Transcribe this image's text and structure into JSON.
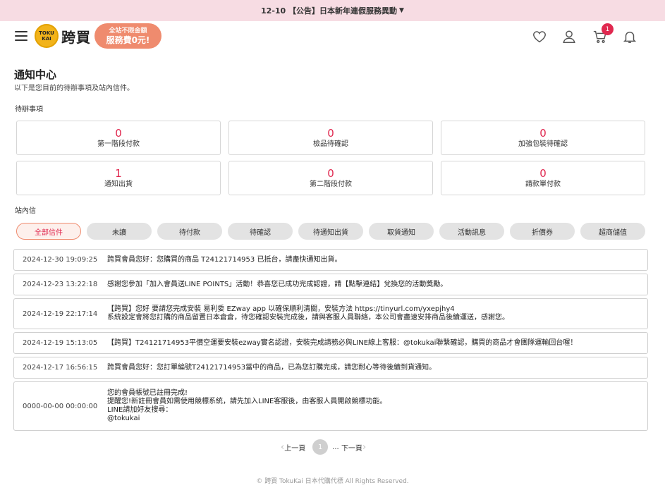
{
  "announcement": {
    "date": "12-10",
    "text": "【公告】日本新年連假服務異動"
  },
  "header": {
    "logo_badge_line1": "TOKU",
    "logo_badge_line2": "KAI",
    "logo_text": "跨買",
    "promo_line1": "全站不限金額",
    "promo_line2": "服務費0元!",
    "cart_count": "1",
    "icons": [
      "menu-icon",
      "heart-icon",
      "user-icon",
      "cart-icon",
      "bell-icon"
    ]
  },
  "page": {
    "title": "通知中心",
    "subtitle": "以下是您目前的待辦事項及站內信件。"
  },
  "todo": {
    "section_label": "待辦事項",
    "items": [
      {
        "count": "0",
        "label": "第一階段付款"
      },
      {
        "count": "0",
        "label": "檢品待確認"
      },
      {
        "count": "0",
        "label": "加強包裝待確認"
      },
      {
        "count": "1",
        "label": "通知出貨"
      },
      {
        "count": "0",
        "label": "第二階段付款"
      },
      {
        "count": "0",
        "label": "請款單付款"
      }
    ]
  },
  "inbox": {
    "section_label": "站內信",
    "tabs": [
      "全部信件",
      "未讀",
      "待付款",
      "待確認",
      "待通知出貨",
      "取貨通知",
      "活動訊息",
      "折價券",
      "超商儲值"
    ],
    "active_tab": "全部信件",
    "messages": [
      {
        "date": "2024-12-30 19:09:25",
        "lines": [
          "跨買會員您好：您購買的商品 T24121714953 已抵台，請盡快通知出貨。"
        ]
      },
      {
        "date": "2024-12-23 13:22:18",
        "lines": [
          "感謝您參加「加入會員送LINE POINTS」活動！恭喜您已成功完成認證，請【點擊連結】兌換您的活動獎勵。"
        ]
      },
      {
        "date": "2024-12-19 22:17:14",
        "lines": [
          "【跨買】您好 要請您完成安裝 易利委 EZway app 以確保順利清關，安裝方法 https://tinyurl.com/yxepjhy4",
          "系統設定會將您訂購的商品留置日本倉倉，待您確認安裝完成後，請與客服人員聯絡，本公司會盡速安排商品後續運送，感謝您。"
        ]
      },
      {
        "date": "2024-12-19 15:13:05",
        "lines": [
          "【跨買】T24121714953平價空運要安裝ezway實名認證，安裝完成請務必與LINE線上客服：@tokukai聯繫確認，購買的商品才會團隊運輸回台喔！"
        ]
      },
      {
        "date": "2024-12-17 16:56:15",
        "lines": [
          "跨買會員您好：您訂單編號T24121714953當中的商品，已為您訂購完成，請您耐心等待後續到貨通知。"
        ]
      },
      {
        "date": "0000-00-00 00:00:00",
        "lines": [
          "您的會員帳號已註冊完成!",
          "提醒您!新註冊會員如需使用競標系統，請先加入LINE客服後，由客服人員開啟競標功能。",
          "LINE請加好友搜尋：",
          "@tokukai"
        ]
      }
    ]
  },
  "pagination": {
    "prev": "上一頁",
    "current": "1",
    "ellipsis": "...",
    "next": "下一頁"
  },
  "footer": {
    "text": "© 跨買 TokuKai 日本代購代標 All Rights Reserved."
  }
}
